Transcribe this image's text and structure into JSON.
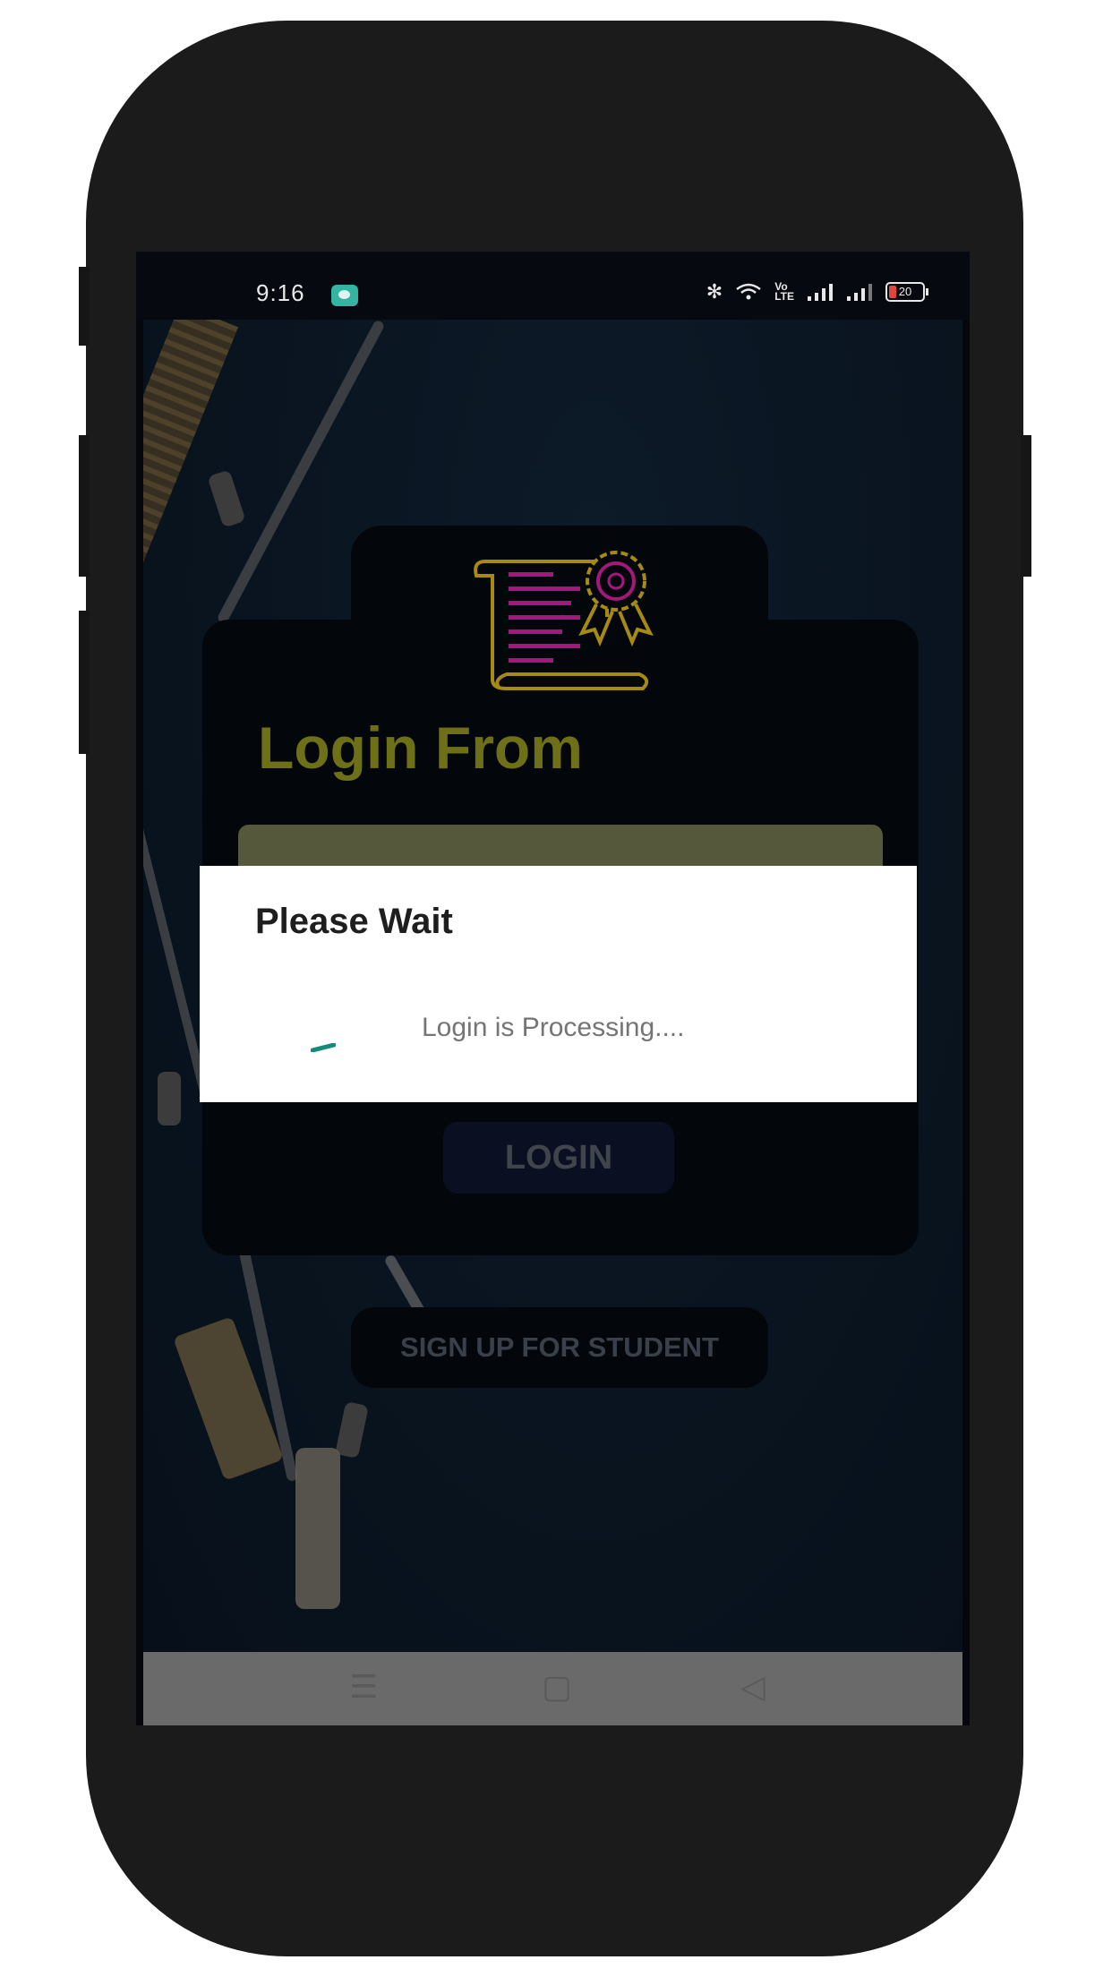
{
  "status_bar": {
    "time": "9:16",
    "icons": [
      "bluetooth-icon",
      "wifi-icon",
      "volte-icon",
      "signal-icon",
      "signal-icon",
      "battery-icon"
    ],
    "volte_label": "Vo\nLTE",
    "battery_level": "20"
  },
  "login_screen": {
    "title": "Login From",
    "email_value": "",
    "login_button": "LOGIN",
    "signup_button": "SIGN UP FOR STUDENT"
  },
  "dialog": {
    "title": "Please Wait",
    "message": "Login is Processing....",
    "spinner_color": "#15897a"
  },
  "nav_bar": {
    "menu_icon": "menu-icon",
    "home_icon": "home-icon",
    "back_icon": "back-icon"
  },
  "colors": {
    "title": "#6e7017",
    "card": "#03060b",
    "logo_outline": "#a68a14",
    "logo_lines": "#a3187a"
  }
}
